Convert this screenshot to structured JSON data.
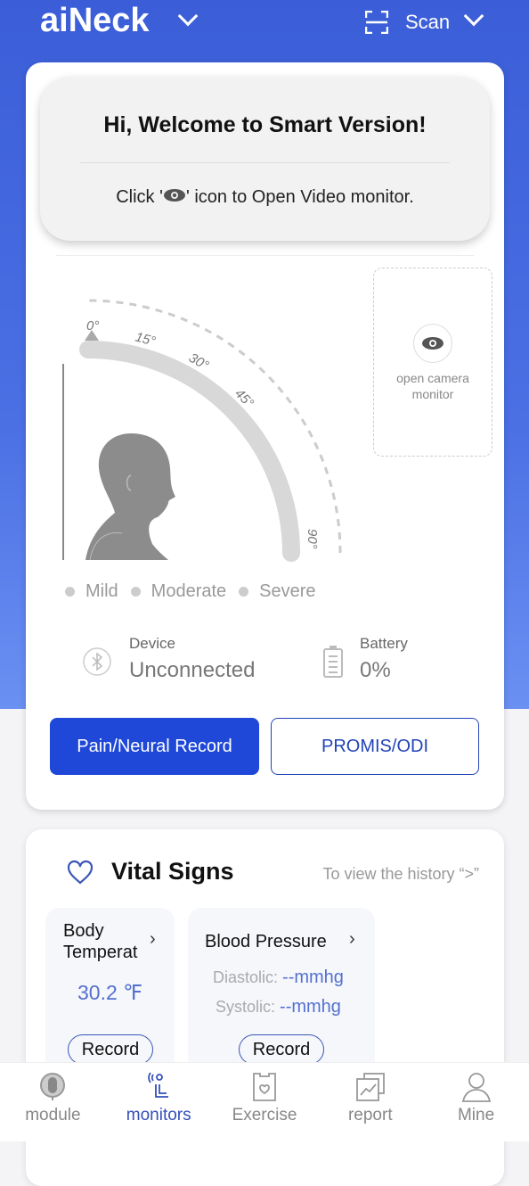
{
  "header": {
    "title": "aiNeck",
    "scan_label": "Scan"
  },
  "welcome": {
    "title": "Hi, Welcome to Smart Version!",
    "hint_before": "Click '",
    "hint_after": "' icon to Open Video monitor."
  },
  "gauge": {
    "ticks": [
      "0°",
      "15°",
      "30°",
      "45°",
      "90°"
    ],
    "current_angle_deg": 0
  },
  "camera": {
    "label_line1": "open camera",
    "label_line2": "monitor"
  },
  "legend": [
    "Mild",
    "Moderate",
    "Severe"
  ],
  "device": {
    "label": "Device",
    "value": "Unconnected"
  },
  "battery": {
    "label": "Battery",
    "value": "0%"
  },
  "buttons": {
    "pain": "Pain/Neural Record",
    "promis": "PROMIS/ODI"
  },
  "vitals": {
    "title": "Vital Signs",
    "history": "To view the history “>”",
    "temp": {
      "title_line1": "Body",
      "title_line2": "Temperat",
      "value": "30.2 ℉",
      "record": "Record"
    },
    "bp": {
      "title": "Blood Pressure",
      "dia_label": "Diastolic: ",
      "dia_value": "--mmhg",
      "sys_label": "Systolic: ",
      "sys_value": "--mmhg",
      "record": "Record"
    }
  },
  "nav": {
    "items": [
      {
        "label": "module"
      },
      {
        "label": "monitors"
      },
      {
        "label": "Exercise"
      },
      {
        "label": "report"
      },
      {
        "label": "Mine"
      }
    ],
    "active": "monitors"
  },
  "colors": {
    "primary": "#1f48d8",
    "header": "#3b5ed8",
    "accent_text": "#5470d0"
  }
}
